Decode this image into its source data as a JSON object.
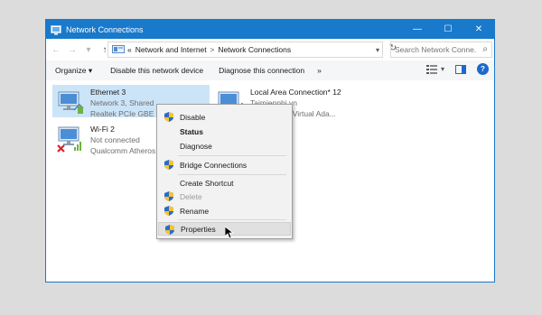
{
  "window": {
    "title": "Network Connections",
    "controls": {
      "minimize": "—",
      "maximize": "☐",
      "close": "✕"
    }
  },
  "nav": {
    "back": "←",
    "forward": "→",
    "up": "↑",
    "breadcrumb": [
      "Network and Internet",
      "Network Connections"
    ],
    "breadcrumb_prefix": "«",
    "breadcrumb_separator": ">",
    "search_placeholder": "Search Network Conne..."
  },
  "toolbar": {
    "organize": "Organize ▾",
    "disable": "Disable this network device",
    "diagnose": "Diagnose this connection",
    "more": "»"
  },
  "connections": [
    {
      "name": "Ethernet 3",
      "status": "Network  3, Shared",
      "device": "Realtek PCIe GBE Fam",
      "selected": true
    },
    {
      "name": "Local Area Connection* 12",
      "status": "Taimienphi.vn",
      "device": "Wi-Fi Direct Virtual Ada..."
    },
    {
      "name": "Wi-Fi 2",
      "status": "Not connected",
      "device": "Qualcomm Atheros C"
    }
  ],
  "context_menu": {
    "items": [
      {
        "label": "Disable",
        "shield": true
      },
      {
        "label": "Status",
        "bold": true
      },
      {
        "label": "Diagnose"
      },
      {
        "label": "Bridge Connections",
        "shield": true
      },
      {
        "label": "Create Shortcut"
      },
      {
        "label": "Delete",
        "shield": true,
        "disabled": true
      },
      {
        "label": "Rename",
        "shield": true
      },
      {
        "label": "Properties",
        "shield": true,
        "highlighted": true
      }
    ]
  },
  "colors": {
    "titlebar": "#1979ca",
    "selection": "#cce4f7",
    "accent": "#1c69c9"
  }
}
